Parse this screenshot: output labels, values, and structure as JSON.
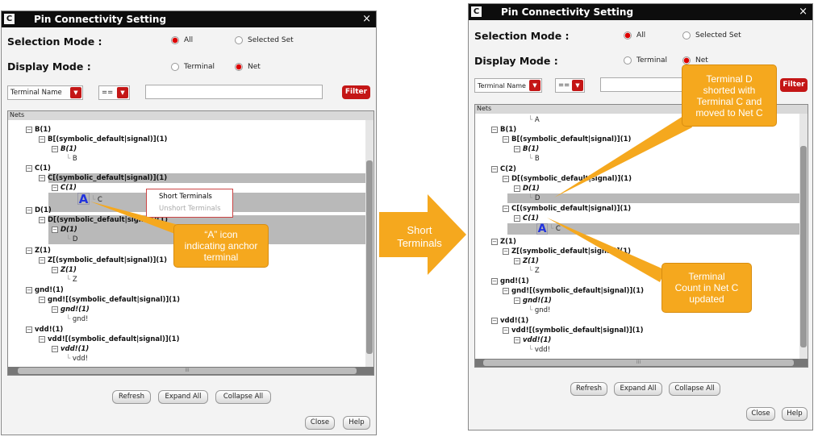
{
  "left": {
    "title": "Pin Connectivity Setting",
    "selection_mode_label": "Selection Mode :",
    "sel_all": "All",
    "sel_set": "Selected Set",
    "display_mode_label": "Display Mode :",
    "disp_terminal": "Terminal",
    "disp_net": "Net",
    "combo_field": "Terminal Name",
    "combo_op": "==",
    "filter": "Filter",
    "tree_header": "Nets",
    "rows": [
      "B(1)",
      "B[(symbolic_default|signal)](1)",
      "B(1)",
      "B",
      "C(1)",
      "C[(symbolic_default|signal)](1)",
      "C(1)",
      "C",
      "D(1)",
      "D[(symbolic_default|signal)](1)",
      "D(1)",
      "D",
      "Z(1)",
      "Z[(symbolic_default|signal)](1)",
      "Z(1)",
      "Z",
      "gnd!(1)",
      "gnd![(symbolic_default|signal)](1)",
      "gnd!(1)",
      "gnd!",
      "vdd!(1)",
      "vdd![(symbolic_default|signal)](1)",
      "vdd!(1)",
      "vdd!"
    ],
    "anchor_glyph": "A",
    "ctx_short": "Short Terminals",
    "ctx_unshort": "Unshort Terminals",
    "hscroll_mark": "III",
    "refresh": "Refresh",
    "expand": "Expand All",
    "collapse": "Collapse All",
    "close": "Close",
    "help": "Help"
  },
  "right": {
    "title": "Pin Connectivity Setting",
    "selection_mode_label": "Selection Mode :",
    "sel_all": "All",
    "sel_set": "Selected Set",
    "display_mode_label": "Display Mode :",
    "disp_terminal": "Terminal",
    "disp_net": "Net",
    "combo_field": "Terminal Name",
    "combo_op": "==",
    "filter": "Filter",
    "tree_header": "Nets",
    "rows": [
      "A",
      "B(1)",
      "B[(symbolic_default|signal)](1)",
      "B(1)",
      "B",
      "C(2)",
      "D[(symbolic_default|signal)](1)",
      "D(1)",
      "D",
      "C[(symbolic_default|signal)](1)",
      "C(1)",
      "C",
      "Z(1)",
      "Z[(symbolic_default|signal)](1)",
      "Z(1)",
      "Z",
      "gnd!(1)",
      "gnd![(symbolic_default|signal)](1)",
      "gnd!(1)",
      "gnd!",
      "vdd!(1)",
      "vdd![(symbolic_default|signal)](1)",
      "vdd!(1)",
      "vdd!"
    ],
    "anchor_glyph": "A",
    "hscroll_mark": "III",
    "refresh": "Refresh",
    "expand": "Expand All",
    "collapse": "Collapse All",
    "close": "Close",
    "help": "Help"
  },
  "callouts": {
    "anchor_line1": "“A” icon",
    "anchor_line2": "indicating anchor",
    "anchor_line3": "terminal",
    "middle_line1": "Short",
    "middle_line2": "Terminals",
    "shorted_line1": "Terminal D",
    "shorted_line2": "shorted with",
    "shorted_line3": "Terminal C and",
    "shorted_line4": "moved to Net C",
    "count_line1": "Terminal",
    "count_line2": "Count in Net C",
    "count_line3": "updated"
  },
  "colors": {
    "callout": "#f5a81e",
    "accent_red": "#c41616",
    "title_bar": "#0d0d0d"
  }
}
